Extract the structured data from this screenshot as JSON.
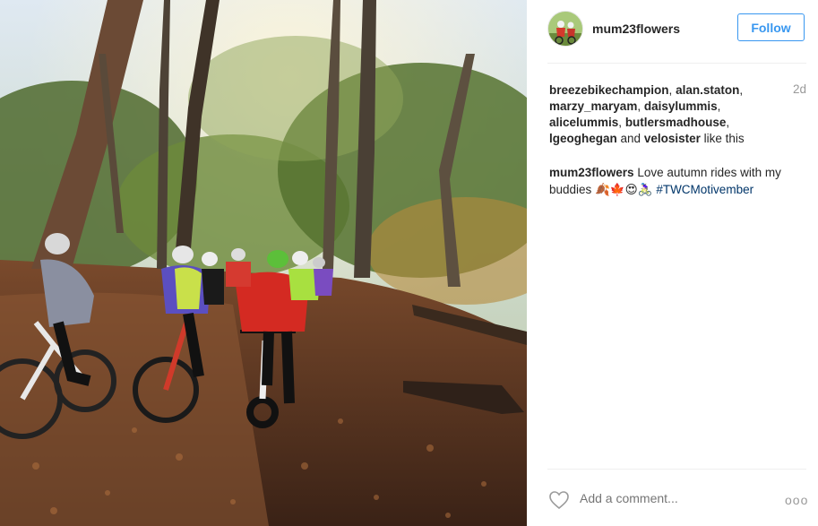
{
  "post": {
    "username": "mum23flowers",
    "follow_label": "Follow",
    "time_ago": "2d",
    "likes": {
      "names": [
        "breezebikechampion",
        "alan.staton",
        "marzy_maryam",
        "daisylummis",
        "alicelummis",
        "butlersmadhouse",
        "lgeoghegan"
      ],
      "last": "velosister",
      "connector": "and",
      "suffix": "like this"
    },
    "caption": {
      "user": "mum23flowers",
      "text": "Love autumn rides with my buddies 🍂🍁😍🚴🏻‍♀️",
      "hashtag": "#TWCMotivember"
    },
    "comment_placeholder": "Add a comment...",
    "more_label": "ooo"
  },
  "icons": {
    "like": "heart-icon",
    "more": "ellipsis-icon"
  },
  "colors": {
    "accent": "#3897f0",
    "hashtag": "#003569",
    "muted": "#999999"
  }
}
